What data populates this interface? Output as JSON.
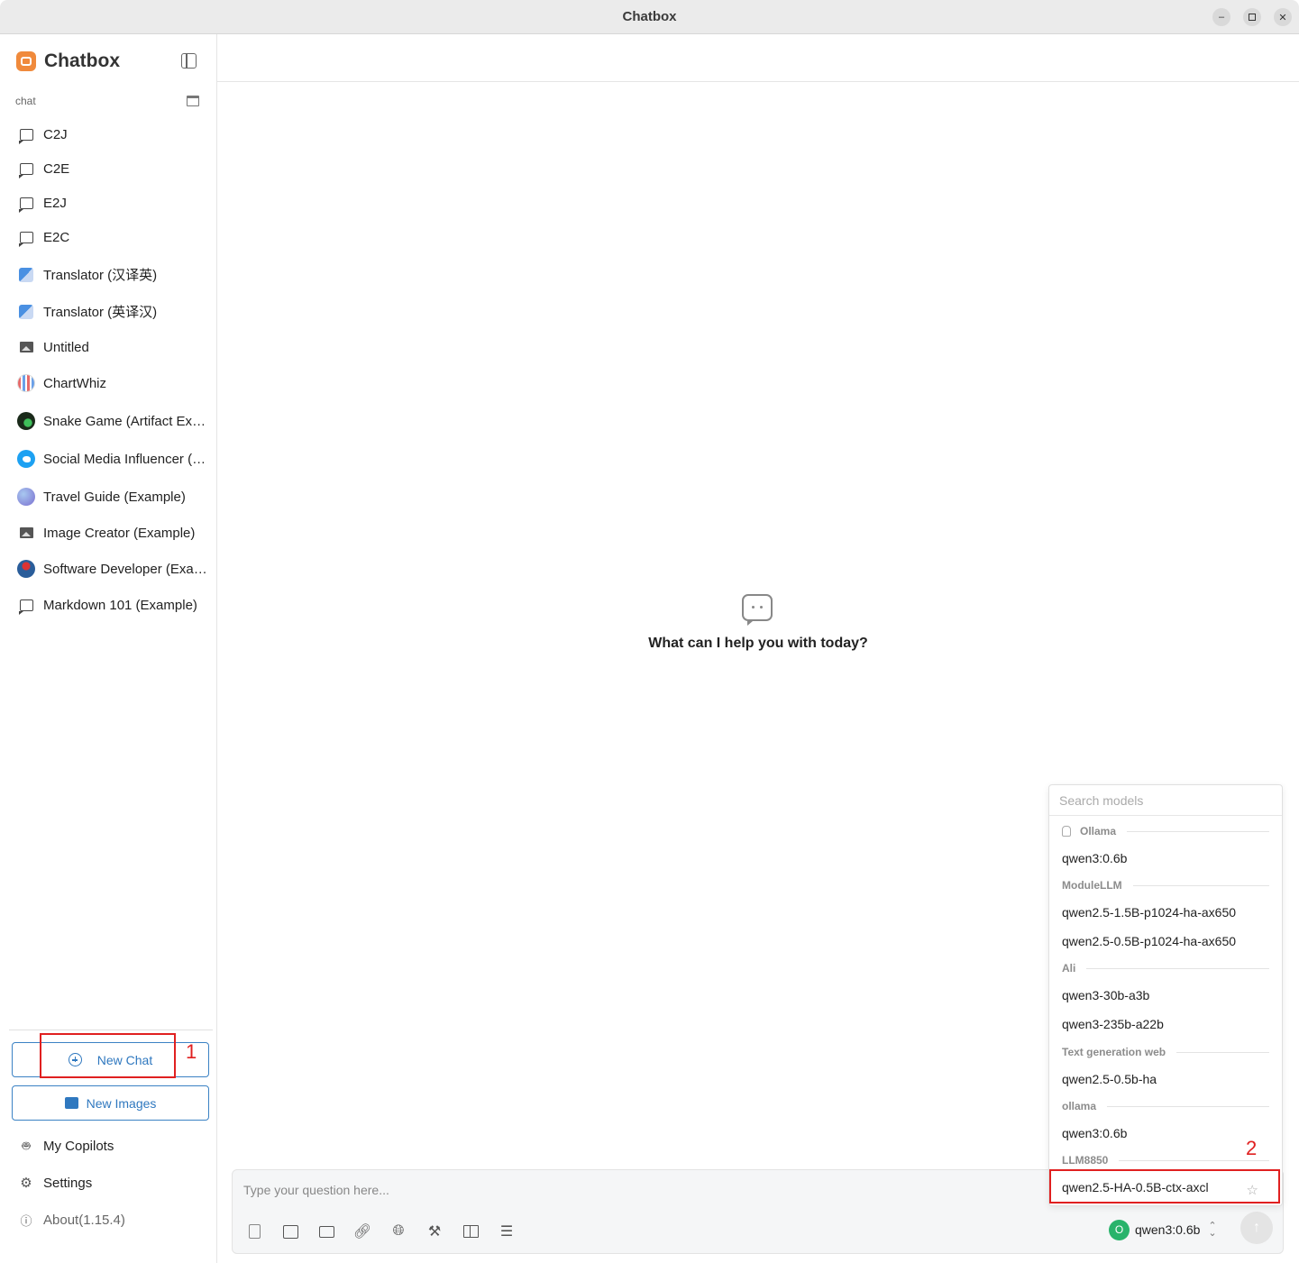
{
  "window": {
    "title": "Chatbox"
  },
  "sidebar": {
    "brand": "Chatbox",
    "section_label": "chat",
    "sessions": [
      {
        "label": "C2J",
        "icon": "chat-bubble-icon"
      },
      {
        "label": "C2E",
        "icon": "chat-bubble-icon"
      },
      {
        "label": "E2J",
        "icon": "chat-bubble-icon"
      },
      {
        "label": "E2C",
        "icon": "chat-bubble-icon"
      },
      {
        "label": "Translator (汉译英)",
        "icon": "translator-avatar-icon"
      },
      {
        "label": "Translator (英译汉)",
        "icon": "translator-avatar-icon"
      },
      {
        "label": "Untitled",
        "icon": "image-icon"
      },
      {
        "label": "ChartWhiz",
        "icon": "chart-avatar-icon"
      },
      {
        "label": "Snake Game (Artifact Example)",
        "icon": "snake-avatar-icon"
      },
      {
        "label": "Social Media Influencer (Example)",
        "icon": "twitter-avatar-icon"
      },
      {
        "label": "Travel Guide (Example)",
        "icon": "globe-avatar-icon"
      },
      {
        "label": "Image Creator (Example)",
        "icon": "image-icon"
      },
      {
        "label": "Software Developer (Example)",
        "icon": "developer-avatar-icon"
      },
      {
        "label": "Markdown 101 (Example)",
        "icon": "chat-bubble-icon"
      }
    ],
    "new_chat_label": "New Chat",
    "new_images_label": "New Images",
    "my_copilots_label": "My Copilots",
    "settings_label": "Settings",
    "about_label": "About(1.15.4)"
  },
  "annotations": {
    "box1": "1",
    "box2": "2"
  },
  "main": {
    "welcome_text": "What can I help you with today?",
    "input_placeholder": "Type your question here...",
    "current_model": "qwen3:0.6b",
    "current_model_avatar": "O"
  },
  "model_dropdown": {
    "search_placeholder": "Search models",
    "groups": [
      {
        "name": "Ollama",
        "models": [
          "qwen3:0.6b"
        ]
      },
      {
        "name": "ModuleLLM",
        "models": [
          "qwen2.5-1.5B-p1024-ha-ax650",
          "qwen2.5-0.5B-p1024-ha-ax650"
        ]
      },
      {
        "name": "Ali",
        "models": [
          "qwen3-30b-a3b",
          "qwen3-235b-a22b"
        ]
      },
      {
        "name": "Text generation web",
        "models": [
          "qwen2.5-0.5b-ha"
        ]
      },
      {
        "name": "ollama",
        "models": [
          "qwen3:0.6b"
        ]
      },
      {
        "name": "LLM8850",
        "models": [
          "qwen2.5-HA-0.5B-ctx-axcl"
        ]
      }
    ]
  },
  "colors": {
    "accent": "#2f78bf",
    "annotation": "#e02020",
    "model_avatar": "#29b36b"
  }
}
